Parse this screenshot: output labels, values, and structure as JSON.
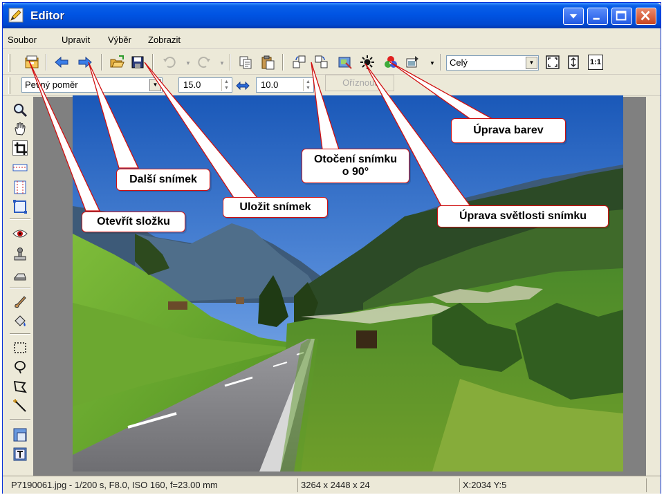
{
  "window": {
    "title": "Editor"
  },
  "menu": [
    {
      "label": "Soubor"
    },
    {
      "label": "Upravit"
    },
    {
      "label": "Výběr"
    },
    {
      "label": "Zobrazit"
    }
  ],
  "toolbar": {
    "zoom_select": "Celý",
    "actual_size_label": "1:1"
  },
  "toolbar2": {
    "ratio_select": "Pevný poměr",
    "width_value": "15.0",
    "height_value": "10.0",
    "crop_label": "Oříznout"
  },
  "callouts": {
    "open_folder": "Otevřít složku",
    "next_image": "Další snímek",
    "save_image": "Uložit snímek",
    "rotate_line1": "Otočení snímku",
    "rotate_line2": "o 90°",
    "color_adjust": "Úprava barev",
    "brightness_adjust": "Úprava světlosti snímku"
  },
  "statusbar": {
    "file_info": "P7190061.jpg - 1/200 s, F8.0, ISO 160, f=23.00 mm",
    "dimensions": "3264 x 2448 x 24",
    "coords": "X:2034  Y:5"
  },
  "colors": {
    "callout_border": "#d01010",
    "title_bar": "#0054e3"
  }
}
